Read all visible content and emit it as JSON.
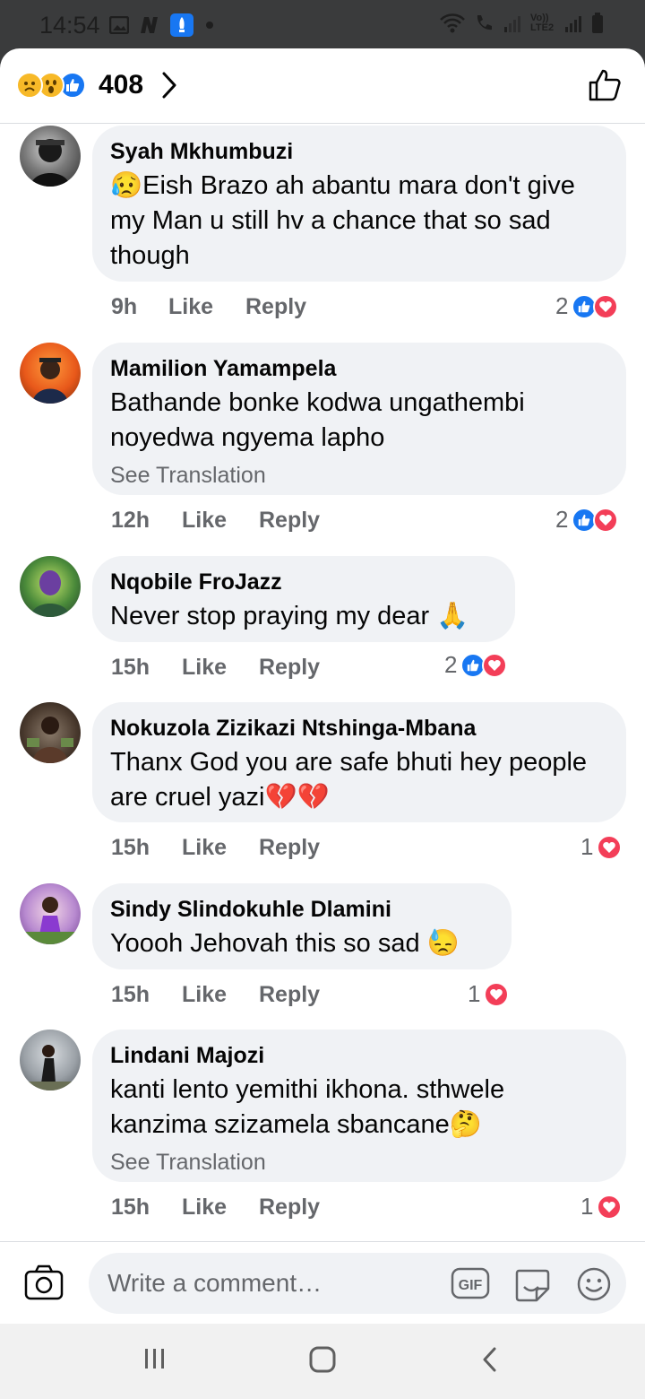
{
  "status_bar": {
    "time": "14:54",
    "network_label": "Vo)) LTE2",
    "icons": [
      "gallery-icon",
      "n-app-icon",
      "rocket-app-icon",
      "dot",
      "wifi-icon",
      "call-icon",
      "signal-icon",
      "signal-icon",
      "battery-icon"
    ]
  },
  "header": {
    "reaction_count": "408",
    "reaction_icons": [
      "sad-emoji-icon",
      "wow-emoji-icon",
      "like-reaction-icon"
    ],
    "like_icon": "thumbs-up-outline-icon"
  },
  "comments": [
    {
      "name": "Syah Mkhumbuzi",
      "text": "😥Eish Brazo ah abantu mara don't give my Man u still hv a chance that so sad though",
      "see_translation": "",
      "age": "9h",
      "like_label": "Like",
      "reply_label": "Reply",
      "reaction_count": "2",
      "reactions": [
        "like",
        "love"
      ]
    },
    {
      "name": "Mamilion Yamampela",
      "text": "Bathande bonke kodwa ungathembi noyedwa ngyema lapho",
      "see_translation": "See Translation",
      "age": "12h",
      "like_label": "Like",
      "reply_label": "Reply",
      "reaction_count": "2",
      "reactions": [
        "like",
        "love"
      ]
    },
    {
      "name": "Nqobile FroJazz",
      "text": "Never stop praying my dear 🙏",
      "see_translation": "",
      "age": "15h",
      "like_label": "Like",
      "reply_label": "Reply",
      "reaction_count": "2",
      "reactions": [
        "like",
        "love"
      ]
    },
    {
      "name": "Nokuzola Zizikazi Ntshinga-Mbana",
      "text": "Thanx God you are safe bhuti hey people are cruel yazi💔💔",
      "see_translation": "",
      "age": "15h",
      "like_label": "Like",
      "reply_label": "Reply",
      "reaction_count": "1",
      "reactions": [
        "love"
      ]
    },
    {
      "name": "Sindy Slindokuhle Dlamini",
      "text": "Yoooh Jehovah this so sad 😓",
      "see_translation": "",
      "age": "15h",
      "like_label": "Like",
      "reply_label": "Reply",
      "reaction_count": "1",
      "reactions": [
        "love"
      ]
    },
    {
      "name": "Lindani Majozi",
      "text": "kanti lento yemithi ikhona. sthwele kanzima szizamela sbancane🤔",
      "see_translation": "See Translation",
      "age": "15h",
      "like_label": "Like",
      "reply_label": "Reply",
      "reaction_count": "1",
      "reactions": [
        "love"
      ]
    }
  ],
  "composer": {
    "placeholder": "Write a comment…",
    "gif_label": "GIF"
  },
  "colors": {
    "facebook_blue": "#1877f2",
    "love_red": "#f33e58",
    "bubble_bg": "#f0f2f5",
    "muted_text": "#65676b"
  }
}
